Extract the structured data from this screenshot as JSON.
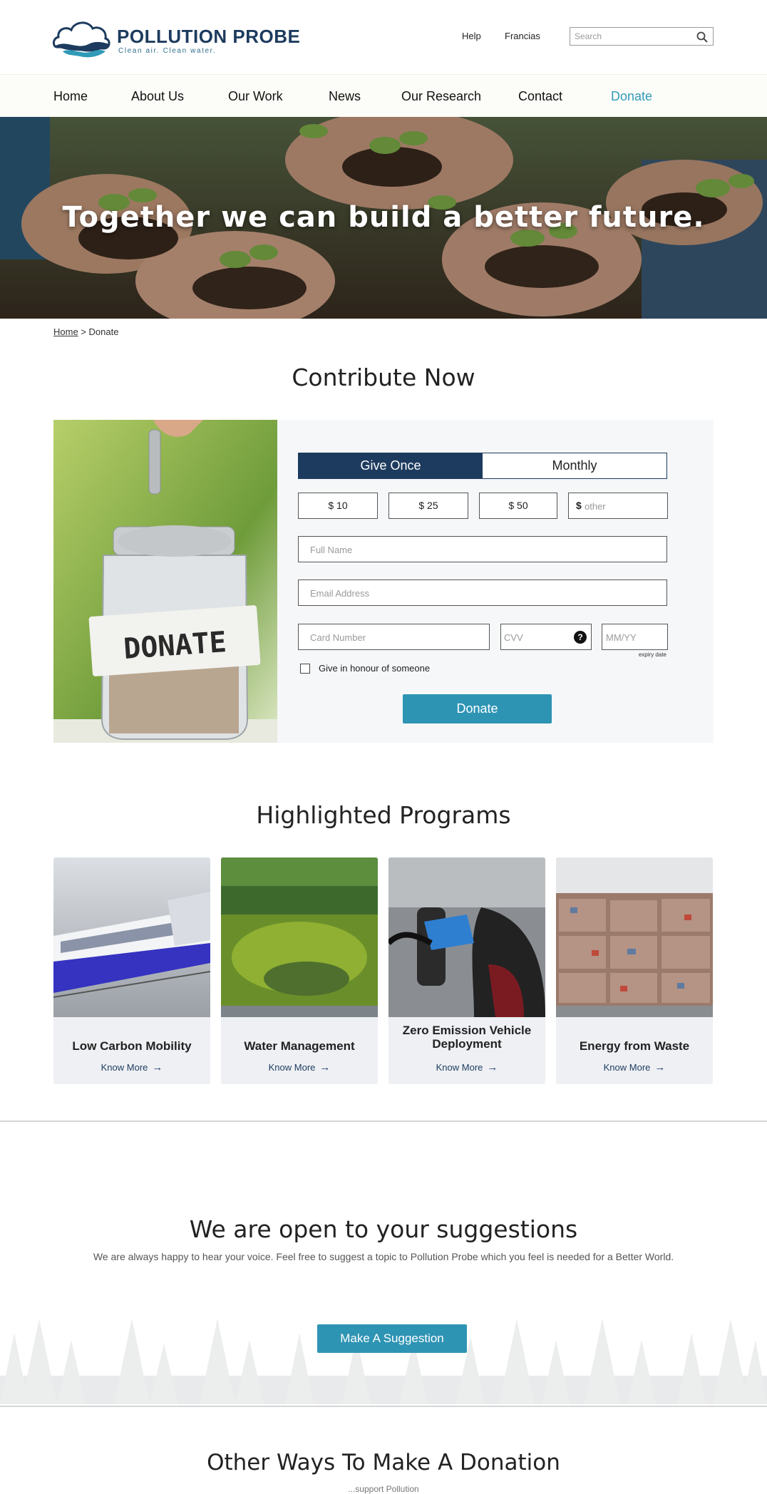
{
  "brand": {
    "name": "POLLUTION PROBE",
    "tagline": "Clean air. Clean water.",
    "color": "#1d3b5e",
    "accent": "#2e94b4"
  },
  "utility": {
    "help": "Help",
    "language": "Francias",
    "search_placeholder": "Search",
    "search_icon": "search-icon"
  },
  "nav": [
    {
      "label": "Home"
    },
    {
      "label": "About Us"
    },
    {
      "label": "Our Work"
    },
    {
      "label": "News"
    },
    {
      "label": "Our Research"
    },
    {
      "label": "Contact"
    },
    {
      "label": "Donate"
    }
  ],
  "hero": {
    "title": "Together we can build a better future."
  },
  "breadcrumb": {
    "home": "Home",
    "separator": ">",
    "current": "Donate"
  },
  "contribute": {
    "title": "Contribute Now",
    "image_label": "DONATE",
    "frequency": [
      "Give Once",
      "Monthly"
    ],
    "selected_frequency": "Give Once",
    "amounts": [
      "$ 10",
      "$ 25",
      "$ 50"
    ],
    "other_currency": "$",
    "other_placeholder": "other",
    "full_name_placeholder": "Full Name",
    "email_placeholder": "Email Address",
    "card_placeholder": "Card Number",
    "cvv_placeholder": "CVV",
    "cvv_help": "?",
    "expiry_placeholder": "MM/YY",
    "expiry_note": "expiry date",
    "honour_label": "Give in honour of someone",
    "donate_button": "Donate"
  },
  "programs": {
    "title": "Highlighted Programs",
    "link_label": "Know More",
    "items": [
      {
        "title": "Low Carbon Mobility"
      },
      {
        "title": "Water Management"
      },
      {
        "title": "Zero Emission Vehicle Deployment"
      },
      {
        "title": "Energy from Waste"
      }
    ]
  },
  "suggestions": {
    "title": "We are open to your suggestions",
    "text": "We are always happy to hear your voice. Feel free to suggest a topic to Pollution Probe which you feel is needed for a Better World.",
    "button": "Make A Suggestion"
  },
  "other_ways": {
    "title": "Other Ways To Make A Donation",
    "subtitle": "...support Pollution"
  }
}
